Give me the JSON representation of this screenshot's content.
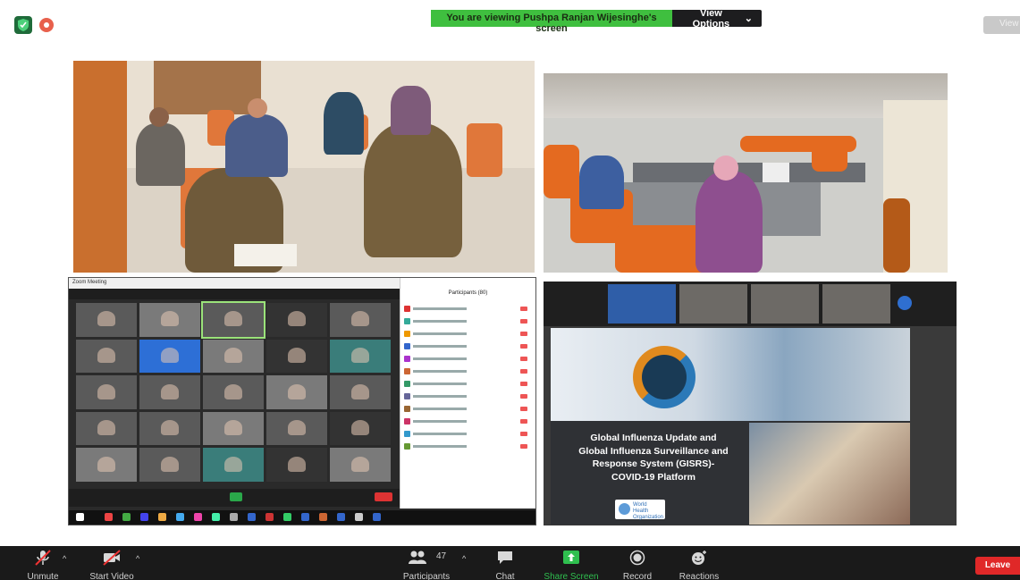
{
  "banner": {
    "viewing_text": "You are viewing Pushpa Ranjan Wijesinghe's screen",
    "view_options": "View Options"
  },
  "top_right": {
    "view_label": "View"
  },
  "shared_screen": {
    "zoom_window_title": "Zoom Meeting",
    "participants_title": "Participants (80)",
    "slide": {
      "title_line1": "Global Influenza Update and",
      "title_line2": "Global Influenza Surveillance and",
      "title_line3": "Response System (GISRS)-",
      "title_line4": "COVID-19 Platform",
      "logo_text": "World Health Organization"
    }
  },
  "toolbar": {
    "unmute": "Unmute",
    "start_video": "Start Video",
    "participants": "Participants",
    "participants_count": "47",
    "chat": "Chat",
    "share_screen": "Share Screen",
    "record": "Record",
    "reactions": "Reactions",
    "leave": "Leave"
  },
  "colors": {
    "banner_green": "#3fbf3f",
    "leave_red": "#e02828",
    "share_green": "#2fbf4f",
    "toolbar_bg": "#1a1a1a"
  }
}
